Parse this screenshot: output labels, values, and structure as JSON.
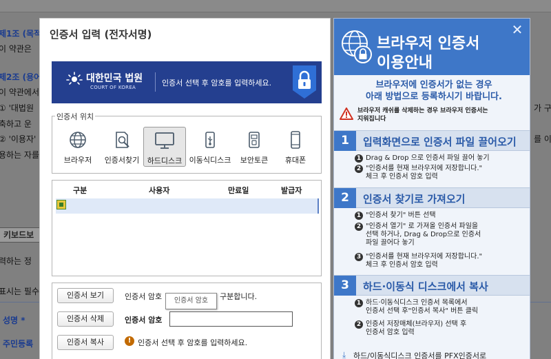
{
  "background": {
    "lines": [
      {
        "text": "제1조 (목적",
        "cls": "blue"
      },
      {
        "text": "이 약관은",
        "cls": ""
      },
      {
        "text": "제2조 (용어",
        "cls": "blue"
      },
      {
        "text": "이 약관에서",
        "cls": ""
      },
      {
        "text": "① '대법원",
        "cls": ""
      },
      {
        "text": "축하고 운",
        "cls": ""
      },
      {
        "text": "② '이용자'",
        "cls": ""
      },
      {
        "text": "용하는 자를",
        "cls": ""
      }
    ],
    "right_lines": [
      "가 구",
      "를 이"
    ],
    "keyboard_label": "키보드보",
    "lower_lines": [
      {
        "text": "력하는 정",
        "cls": ""
      },
      {
        "text": "표시는 필수",
        "cls": ""
      },
      {
        "text": "성명 *",
        "cls": "blue"
      },
      {
        "text": "주민등록",
        "cls": "blue"
      }
    ]
  },
  "dialog": {
    "title": "인증서 입력 (전자서명)",
    "banner": {
      "org_name": "대한민국 법원",
      "org_sub": "COURT OF KOREA",
      "instruction": "인증서 선택 후 암호를 입력하세요."
    },
    "location_legend": "인증서 위치",
    "locations": [
      {
        "label": "브라우저",
        "icon": "globe-icon"
      },
      {
        "label": "인증서찾기",
        "icon": "file-search-icon"
      },
      {
        "label": "하드디스크",
        "icon": "monitor-icon",
        "selected": true
      },
      {
        "label": "이동식디스크",
        "icon": "usb-icon"
      },
      {
        "label": "보안토큰",
        "icon": "token-icon"
      },
      {
        "label": "휴대폰",
        "icon": "phone-icon"
      }
    ],
    "table_headers": [
      "구분",
      "사용자",
      "만료일",
      "발급자"
    ],
    "buttons": {
      "view": "인증서 보기",
      "delete": "인증서 삭제",
      "copy": "인증서 복사"
    },
    "case_text_a": "인증서 암호",
    "case_text_b": "구분합니다.",
    "tooltip": "인증서 암호",
    "password_label": "인증서 암호",
    "password_value": "",
    "warning_text": "인증서 선택 후 암호를 입력하세요."
  },
  "guide": {
    "title_line1": "브라우저 인증서",
    "title_line2": "이용안내",
    "intro_line1": "브라우저에 인증서가 없는 경우",
    "intro_line2": "아래 방법으로 등록하시기 바랍니다.",
    "warn_line1": "브라우저 캐쉬를 삭제하는 경우 브라우저 인증서는",
    "warn_line2": "지워집니다",
    "sections": [
      {
        "num": "1",
        "title": "입력화면으로 인증서 파일 끌어오기",
        "steps": [
          {
            "n": "1",
            "lines": [
              "Drag & Drop 으로 인증서 파일 끌어 놓기"
            ]
          },
          {
            "n": "2",
            "lines": [
              "\"인증서를 현재 브라우저에 저장합니다.\"",
              "체크 후 인증서 암호 입력"
            ]
          }
        ]
      },
      {
        "num": "2",
        "title": "인증서 찾기로 가져오기",
        "steps": [
          {
            "n": "1",
            "lines": [
              "\"인증서 찾기\" 버튼 선택"
            ]
          },
          {
            "n": "2",
            "lines": [
              "\"인증서 열기\" 로 가져올 인증서 파일을",
              "선택 하거나, Drag & Drop으로 인증서",
              "파일 끌어다 놓기"
            ]
          },
          {
            "n": "3",
            "lines": [
              "\"인증서를 현재 브라우저에 저장합니다.\"",
              "체크 후 인증서 암호 입력"
            ]
          }
        ]
      },
      {
        "num": "3",
        "title": "하드·이동식 디스크에서 복사",
        "steps": [
          {
            "n": "1",
            "lines": [
              "하드·이동식디스크 인증서 목록에서",
              "인증서 선택 후\"인증서 복사\" 버튼 클릭"
            ]
          },
          {
            "n": "2",
            "lines": [
              "인증서 저장매체(브라우저) 선택 후",
              "인증서 암호 입력"
            ]
          }
        ]
      }
    ],
    "footer": "하드/이동식디스크 인증서를 PFX인증서로"
  }
}
